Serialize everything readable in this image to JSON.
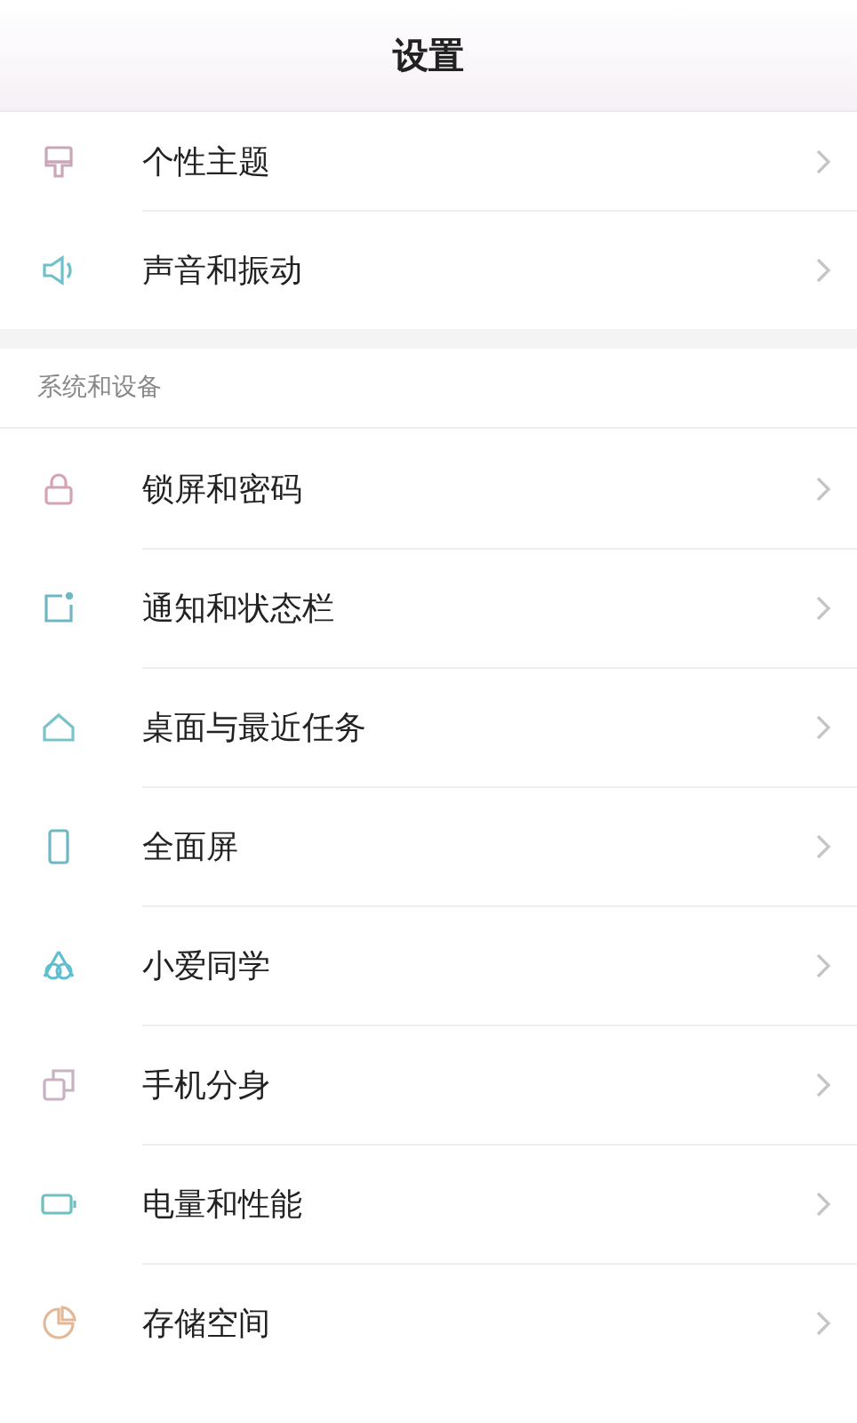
{
  "header": {
    "title": "设置"
  },
  "groups": [
    {
      "items": [
        {
          "label": "个性主题",
          "kind": "brush",
          "color": "#c9a7b8"
        },
        {
          "label": "声音和振动",
          "kind": "speaker",
          "color": "#6fc0c8"
        }
      ]
    },
    {
      "title": "系统和设备",
      "items": [
        {
          "label": "锁屏和密码",
          "kind": "lock",
          "color": "#d4a4b4"
        },
        {
          "label": "通知和状态栏",
          "kind": "notify",
          "color": "#6fb7c4"
        },
        {
          "label": "桌面与最近任务",
          "kind": "home",
          "color": "#7cc3c9"
        },
        {
          "label": "全面屏",
          "kind": "phone",
          "color": "#6fb7c4"
        },
        {
          "label": "小爱同学",
          "kind": "ai",
          "color": "#5fbfd0"
        },
        {
          "label": "手机分身",
          "kind": "copy",
          "color": "#c9b2c2"
        },
        {
          "label": "电量和性能",
          "kind": "battery",
          "color": "#6fc0c0"
        },
        {
          "label": "存储空间",
          "kind": "pie",
          "color": "#e3b896"
        }
      ]
    }
  ]
}
